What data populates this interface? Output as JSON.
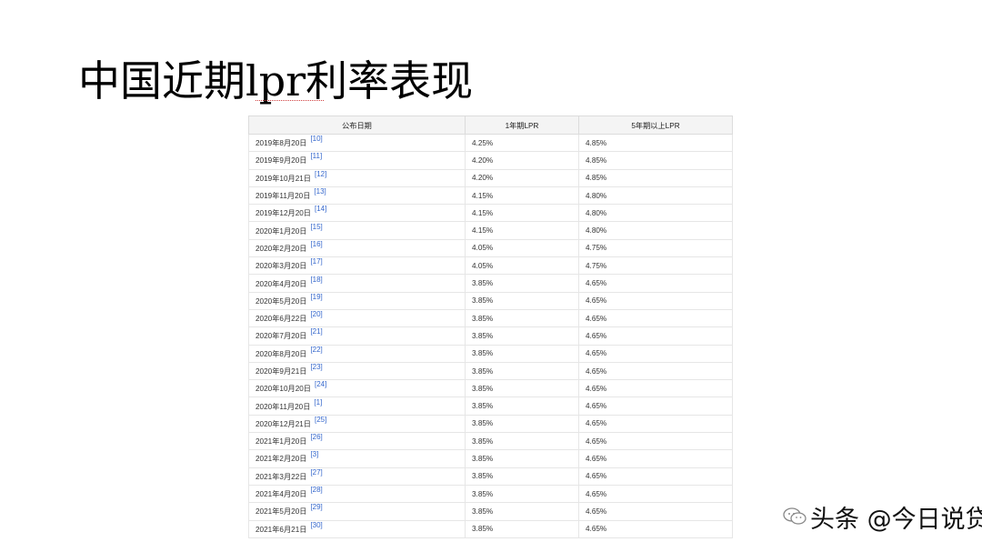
{
  "slide": {
    "title": "中国近期lpr利率表现"
  },
  "table": {
    "headers": [
      "公布日期",
      "1年期LPR",
      "5年期以上LPR"
    ],
    "rows": [
      {
        "date": "2019年8月20日",
        "ref": "[10]",
        "lpr1": "4.25%",
        "lpr5": "4.85%"
      },
      {
        "date": "2019年9月20日",
        "ref": "[11]",
        "lpr1": "4.20%",
        "lpr5": "4.85%"
      },
      {
        "date": "2019年10月21日",
        "ref": "[12]",
        "lpr1": "4.20%",
        "lpr5": "4.85%"
      },
      {
        "date": "2019年11月20日",
        "ref": "[13]",
        "lpr1": "4.15%",
        "lpr5": "4.80%"
      },
      {
        "date": "2019年12月20日",
        "ref": "[14]",
        "lpr1": "4.15%",
        "lpr5": "4.80%"
      },
      {
        "date": "2020年1月20日",
        "ref": "[15]",
        "lpr1": "4.15%",
        "lpr5": "4.80%"
      },
      {
        "date": "2020年2月20日",
        "ref": "[16]",
        "lpr1": "4.05%",
        "lpr5": "4.75%"
      },
      {
        "date": "2020年3月20日",
        "ref": "[17]",
        "lpr1": "4.05%",
        "lpr5": "4.75%"
      },
      {
        "date": "2020年4月20日",
        "ref": "[18]",
        "lpr1": "3.85%",
        "lpr5": "4.65%"
      },
      {
        "date": "2020年5月20日",
        "ref": "[19]",
        "lpr1": "3.85%",
        "lpr5": "4.65%"
      },
      {
        "date": "2020年6月22日",
        "ref": "[20]",
        "lpr1": "3.85%",
        "lpr5": "4.65%"
      },
      {
        "date": "2020年7月20日",
        "ref": "[21]",
        "lpr1": "3.85%",
        "lpr5": "4.65%"
      },
      {
        "date": "2020年8月20日",
        "ref": "[22]",
        "lpr1": "3.85%",
        "lpr5": "4.65%"
      },
      {
        "date": "2020年9月21日",
        "ref": "[23]",
        "lpr1": "3.85%",
        "lpr5": "4.65%"
      },
      {
        "date": "2020年10月20日",
        "ref": "[24]",
        "lpr1": "3.85%",
        "lpr5": "4.65%"
      },
      {
        "date": "2020年11月20日",
        "ref": "[1]",
        "lpr1": "3.85%",
        "lpr5": "4.65%"
      },
      {
        "date": "2020年12月21日",
        "ref": "[25]",
        "lpr1": "3.85%",
        "lpr5": "4.65%"
      },
      {
        "date": "2021年1月20日",
        "ref": "[26]",
        "lpr1": "3.85%",
        "lpr5": "4.65%"
      },
      {
        "date": "2021年2月20日",
        "ref": "[3]",
        "lpr1": "3.85%",
        "lpr5": "4.65%"
      },
      {
        "date": "2021年3月22日",
        "ref": "[27]",
        "lpr1": "3.85%",
        "lpr5": "4.65%"
      },
      {
        "date": "2021年4月20日",
        "ref": "[28]",
        "lpr1": "3.85%",
        "lpr5": "4.65%"
      },
      {
        "date": "2021年5月20日",
        "ref": "[29]",
        "lpr1": "3.85%",
        "lpr5": "4.65%"
      },
      {
        "date": "2021年6月21日",
        "ref": "[30]",
        "lpr1": "3.85%",
        "lpr5": "4.65%"
      }
    ]
  },
  "watermark": {
    "text": "头条 @今日说贷",
    "icon": "wechat-icon"
  },
  "colors": {
    "ref_link": "#3366cc",
    "header_bg": "#f4f4f4"
  }
}
